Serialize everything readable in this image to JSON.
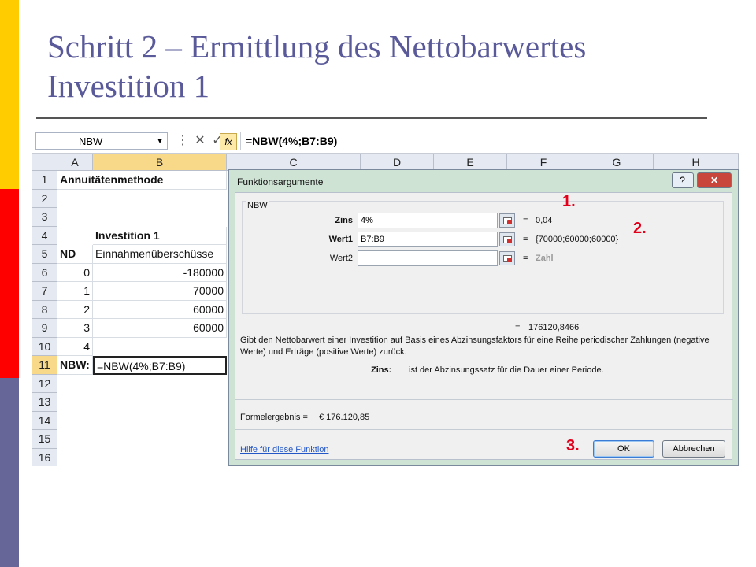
{
  "slide": {
    "title_line1": "Schritt 2 – Ermittlung des Nettobarwertes",
    "title_line2": "Investition 1",
    "accent_colors": [
      "#ffcc00",
      "#ff0000",
      "#666699"
    ]
  },
  "excel": {
    "name_box": "NBW",
    "formula": "=NBW(4%;B7:B9)",
    "fx_label": "fx",
    "columns": [
      "A",
      "B",
      "C",
      "D",
      "E",
      "F",
      "G",
      "H"
    ],
    "rows": [
      "1",
      "2",
      "3",
      "4",
      "5",
      "6",
      "7",
      "8",
      "9",
      "10",
      "11",
      "12",
      "13",
      "14",
      "15",
      "16"
    ],
    "cells": {
      "A1": "Annuitätenmethode",
      "B4": "Investition 1",
      "A5": "ND",
      "B5": "Einnahmenüberschüsse",
      "A6": "0",
      "B6": "-180000",
      "A7": "1",
      "B7": "70000",
      "A8": "2",
      "B8": "60000",
      "A9": "3",
      "B9": "60000",
      "A10": "4",
      "A11": "NBW:",
      "B11": "=NBW(4%;B7:B9)"
    }
  },
  "dialog": {
    "title": "Funktionsargumente",
    "help_glyph": "?",
    "close_glyph": "✕",
    "group_label": "NBW",
    "args": [
      {
        "label": "Zins",
        "value": "4%",
        "result": "0,04"
      },
      {
        "label": "Wert1",
        "value": "B7:B9",
        "result": "{70000;60000;60000}"
      },
      {
        "label": "Wert2",
        "value": "",
        "result": "Zahl"
      }
    ],
    "equals": "=",
    "total_result": "176120,8466",
    "description": "Gibt den Nettobarwert  einer Investition auf Basis eines Abzinsungsfaktors für eine Reihe periodischer Zahlungen (negative Werte) und Erträge (positive Werte) zurück.",
    "param_name": "Zins:",
    "param_desc": "ist der Abzinsungssatz für die Dauer einer Periode.",
    "formula_result_label": "Formelergebnis =",
    "formula_result_value": "€ 176.120,85",
    "help_link": "Hilfe für diese Funktion",
    "ok_label": "OK",
    "cancel_label": "Abbrechen"
  },
  "markers": [
    "1.",
    "2.",
    "3."
  ]
}
